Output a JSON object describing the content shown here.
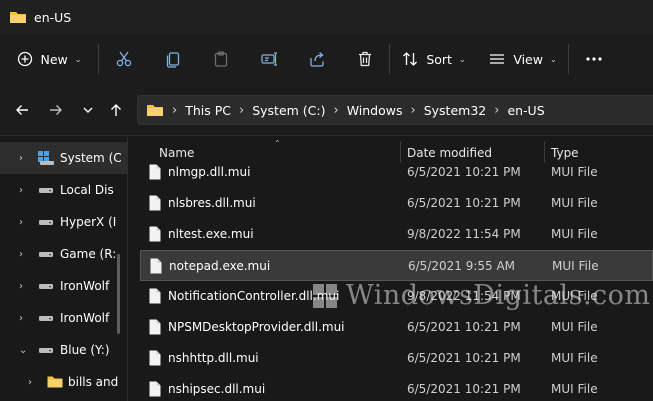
{
  "window": {
    "title": "en-US",
    "icon": "folder-icon",
    "accent_folder_color": "#f3c13a"
  },
  "toolbar": {
    "new_label": "New",
    "sort_label": "Sort",
    "view_label": "View",
    "icons": [
      "plus-circle-icon",
      "cut-icon",
      "copy-icon",
      "paste-icon",
      "rename-icon",
      "share-icon",
      "delete-icon",
      "sort-icon",
      "view-icon",
      "more-icon"
    ]
  },
  "nav": {
    "breadcrumb": [
      "This PC",
      "System (C:)",
      "Windows",
      "System32",
      "en-US"
    ]
  },
  "sidebar": {
    "items": [
      {
        "label": "System (C",
        "icon": "drive-icon",
        "selected": true,
        "expanded": false
      },
      {
        "label": "Local Dis",
        "icon": "drive-icon",
        "selected": false,
        "expanded": false
      },
      {
        "label": "HyperX (I",
        "icon": "drive-icon",
        "selected": false,
        "expanded": false
      },
      {
        "label": "Game (R:",
        "icon": "drive-icon",
        "selected": false,
        "expanded": false
      },
      {
        "label": "IronWolf",
        "icon": "drive-icon",
        "selected": false,
        "expanded": false
      },
      {
        "label": "IronWolf",
        "icon": "drive-icon",
        "selected": false,
        "expanded": false
      },
      {
        "label": "Blue (Y:)",
        "icon": "drive-icon",
        "selected": false,
        "expanded": true
      },
      {
        "label": "bills and",
        "icon": "folder-icon",
        "selected": false,
        "expanded": false
      }
    ]
  },
  "file_list": {
    "columns": {
      "name": "Name",
      "date": "Date modified",
      "type": "Type"
    },
    "rows": [
      {
        "name": "nlmgp.dll.mui",
        "date": "6/5/2021 10:21 PM",
        "type": "MUI File",
        "highlighted": false
      },
      {
        "name": "nlsbres.dll.mui",
        "date": "6/5/2021 10:21 PM",
        "type": "MUI File",
        "highlighted": false
      },
      {
        "name": "nltest.exe.mui",
        "date": "9/8/2022 11:54 PM",
        "type": "MUI File",
        "highlighted": false
      },
      {
        "name": "notepad.exe.mui",
        "date": "6/5/2021 9:55 AM",
        "type": "MUI File",
        "highlighted": true
      },
      {
        "name": "NotificationController.dll.mui",
        "date": "9/8/2022 11:54 PM",
        "type": "MUI File",
        "highlighted": false
      },
      {
        "name": "NPSMDesktopProvider.dll.mui",
        "date": "6/5/2021 10:21 PM",
        "type": "MUI File",
        "highlighted": false
      },
      {
        "name": "nshhttp.dll.mui",
        "date": "6/5/2021 10:21 PM",
        "type": "MUI File",
        "highlighted": false
      },
      {
        "name": "nshipsec.dll.mui",
        "date": "6/5/2021 10:21 PM",
        "type": "MUI File",
        "highlighted": false
      }
    ]
  },
  "watermark": {
    "text": "WindowsDigitals.com"
  }
}
